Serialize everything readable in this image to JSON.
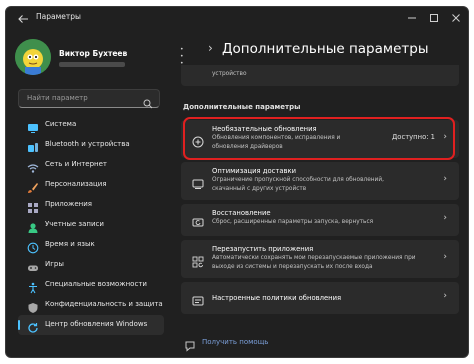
{
  "window": {
    "title": "Параметры",
    "controls": [
      "minimize",
      "maximize",
      "close"
    ]
  },
  "profile": {
    "name": "Виктор Бухтеев"
  },
  "search": {
    "placeholder": "Найти параметр"
  },
  "sidebar": {
    "items": [
      {
        "label": "Система",
        "icon": "monitor-icon",
        "color": "#4cc2ff"
      },
      {
        "label": "Bluetooth и устройства",
        "icon": "bluetooth-icon",
        "color": "#4cc2ff"
      },
      {
        "label": "Сеть и Интернет",
        "icon": "wifi-icon",
        "color": "#9fb7d9"
      },
      {
        "label": "Персонализация",
        "icon": "brush-icon",
        "color": "#f0a35e"
      },
      {
        "label": "Приложения",
        "icon": "apps-icon",
        "color": "#a9a9c4"
      },
      {
        "label": "Учетные записи",
        "icon": "person-icon",
        "color": "#38c984"
      },
      {
        "label": "Время и язык",
        "icon": "globe-clock-icon",
        "color": "#4cc2ff"
      },
      {
        "label": "Игры",
        "icon": "gamepad-icon",
        "color": "#a7a7a7"
      },
      {
        "label": "Специальные возможности",
        "icon": "accessibility-icon",
        "color": "#4cc2ff"
      },
      {
        "label": "Конфиденциальность и защита",
        "icon": "shield-icon",
        "color": "#a7a7a7"
      },
      {
        "label": "Центр обновления Windows",
        "icon": "update-icon",
        "color": "#4cc2ff",
        "active": true
      }
    ]
  },
  "breadcrumb": {
    "ellipsis": "• • •",
    "separator": "›",
    "title": "Дополнительные параметры"
  },
  "top_card": {
    "desc": "устройство"
  },
  "section": {
    "label": "Дополнительные параметры"
  },
  "cards": [
    {
      "title": "Необязательные обновления",
      "desc": "Обновления компонентов, исправления и обновления драйверов",
      "status": "Доступно: 1",
      "icon": "plus-circle-icon"
    },
    {
      "title": "Оптимизация доставки",
      "desc": "Ограничение пропускной способности для обновлений, скачанный с других устройств",
      "icon": "delivery-icon"
    },
    {
      "title": "Восстановление",
      "desc": "Сброс, расширенные параметры запуска, вернуться",
      "icon": "recovery-icon"
    },
    {
      "title": "Перезапустить приложения",
      "desc": "Автоматически сохранять мои перезапускаемые приложения при выходе из системы и перезапускать их после входа",
      "icon": "restart-apps-icon"
    },
    {
      "title": "Настроенные политики обновления",
      "desc": "",
      "icon": "policy-icon"
    }
  ],
  "chevron": "›",
  "help": {
    "label": "Получить помощь"
  }
}
